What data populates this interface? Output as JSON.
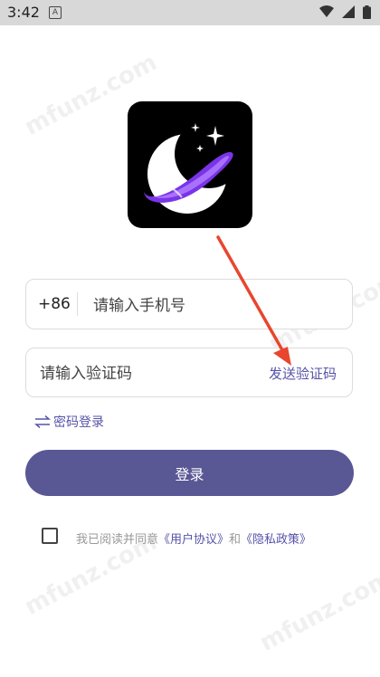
{
  "status_bar": {
    "time": "3:42",
    "notification_glyph": "A",
    "icons": [
      "wifi-icon",
      "signal-icon",
      "battery-icon"
    ]
  },
  "app_icon": {
    "icon_name": "moon-stars-icon",
    "background": "#000000",
    "accent_color": "#8b3dff"
  },
  "form": {
    "country_code": "+86",
    "phone_placeholder": "请输入手机号",
    "code_placeholder": "请输入验证码",
    "send_code_label": "发送验证码"
  },
  "password_login": {
    "label": "密码登录",
    "icon": "swap-icon"
  },
  "login_button": {
    "label": "登录",
    "color": "#5a5795"
  },
  "agreement": {
    "prefix": "我已阅读并同意",
    "user_agreement": "《用户协议》",
    "conjunction": "和",
    "privacy_policy": "《隐私政策》",
    "checked": false
  },
  "watermark": {
    "text": "mfunz.com"
  },
  "colors": {
    "accent": "#5653a8",
    "arrow": "#e8462f"
  }
}
